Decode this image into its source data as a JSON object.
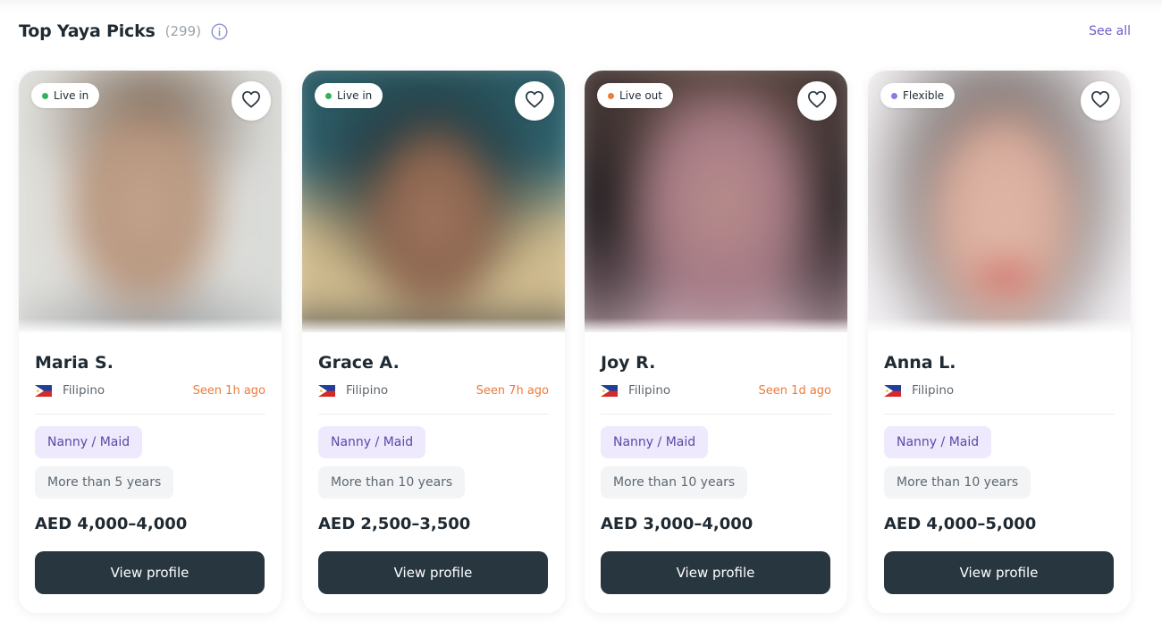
{
  "section": {
    "title": "Top Yaya Picks",
    "count": "(299)",
    "see_all": "See all"
  },
  "cards": [
    {
      "arrangement": "Live in",
      "arrangement_color": "#2fb45a",
      "name": "Maria S.",
      "nationality": "Filipino",
      "seen": "Seen 1h ago",
      "role": "Nanny / Maid",
      "experience": "More than 5 years",
      "salary": "AED 4,000–4,000",
      "button": "View profile"
    },
    {
      "arrangement": "Live in",
      "arrangement_color": "#2fb45a",
      "name": "Grace A.",
      "nationality": "Filipino",
      "seen": "Seen 7h ago",
      "role": "Nanny / Maid",
      "experience": "More than 10 years",
      "salary": "AED 2,500–3,500",
      "button": "View profile"
    },
    {
      "arrangement": "Live out",
      "arrangement_color": "#ef7b3a",
      "name": "Joy R.",
      "nationality": "Filipino",
      "seen": "Seen 1d ago",
      "role": "Nanny / Maid",
      "experience": "More than 10 years",
      "salary": "AED 3,000–4,000",
      "button": "View profile"
    },
    {
      "arrangement": "Flexible",
      "arrangement_color": "#8a7be3",
      "name": "Anna L.",
      "nationality": "Filipino",
      "seen": "",
      "role": "Nanny / Maid",
      "experience": "More than 10 years",
      "salary": "AED 4,000–5,000",
      "button": "View profile"
    }
  ],
  "colors": {
    "accent": "#6b5fc8",
    "seen": "#ec7a3c",
    "button_bg": "#28363f",
    "role_tag_bg": "#eee9fd"
  },
  "icons": {
    "info": "info-icon",
    "favorite": "heart-outline-icon",
    "flag": "philippines-flag-icon"
  }
}
